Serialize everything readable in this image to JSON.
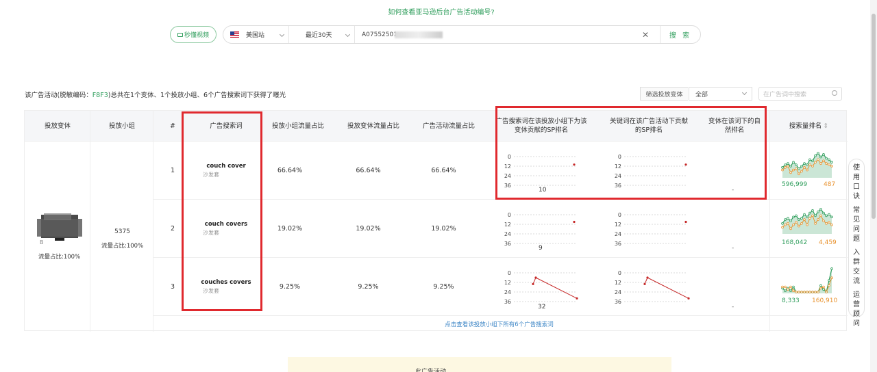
{
  "help_link": "如何查看亚马逊后台广告活动编号?",
  "search": {
    "video_button": "秒懂视频",
    "site": "美国站",
    "range": "最近30天",
    "query": "A07552501",
    "search_button": "搜 索"
  },
  "summary": {
    "prefix": "该广告活动(脱敏编码：",
    "code": "F8F3",
    "suffix": ")总共在1个变体、1个投放小组、6个广告搜索词下获得了曝光"
  },
  "filter": {
    "label": "筛选投放变体",
    "value": "全部",
    "keyword_placeholder": "在广告词中搜索"
  },
  "table": {
    "headers": {
      "variant": "投放变体",
      "group": "投放小组",
      "index": "#",
      "keyword": "广告搜索词",
      "group_share": "投放小组流量占比",
      "variant_share": "投放变体流量占比",
      "campaign_share": "广告活动流量占比",
      "sp_rank_group": "广告搜索词在该投放小组下为该变体贡献的SP排名",
      "sp_rank_campaign": "关键词在该广告活动下贡献的SP排名",
      "organic_rank": "变体在该词下的自然排名",
      "search_volume_rank": "搜索量排名"
    },
    "variant": {
      "code": "B",
      "share": "流量占比:100%"
    },
    "group": {
      "id": "5375",
      "share": "流量占比:100%"
    },
    "axis_ticks": [
      "0",
      "12",
      "24",
      "36"
    ],
    "rows": [
      {
        "index": "1",
        "keyword": "couch cover",
        "keyword_cn": "沙发套",
        "group_share": "66.64%",
        "variant_share": "66.64%",
        "campaign_share": "66.64%",
        "sp_rank": "10",
        "organic": "-",
        "vol_left": "596,999",
        "vol_right": "487"
      },
      {
        "index": "2",
        "keyword": "couch covers",
        "keyword_cn": "沙发套",
        "group_share": "19.02%",
        "variant_share": "19.02%",
        "campaign_share": "19.02%",
        "sp_rank": "9",
        "organic": "-",
        "vol_left": "168,042",
        "vol_right": "4,459"
      },
      {
        "index": "3",
        "keyword": "couches covers",
        "keyword_cn": "沙发套",
        "group_share": "9.25%",
        "variant_share": "9.25%",
        "campaign_share": "9.25%",
        "sp_rank": "32",
        "organic": "-",
        "vol_left": "8,333",
        "vol_right": "160,910"
      }
    ],
    "footer_link": "点击查看该投放小组下所有6个广告搜索词"
  },
  "side_tools": [
    "使用口诀",
    "常见问题",
    "入群交流",
    "运营顾问"
  ],
  "bottom_text": "此广告活动",
  "colors": {
    "accent": "#2e9d5b",
    "highlight": "#e0292e",
    "orange": "#e8922e"
  }
}
